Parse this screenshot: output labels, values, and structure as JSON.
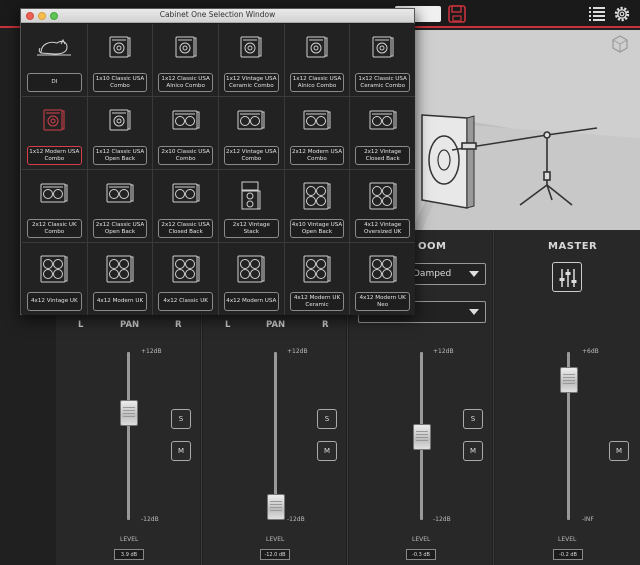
{
  "window": {
    "title": "Cabinet One Selection Window"
  },
  "cabinets": [
    {
      "label": "DI",
      "icon": "di-cat-icon",
      "kind": "di"
    },
    {
      "label": "1x10 Classic USA Combo",
      "icon": "cab-1x10-icon",
      "kind": "combo1"
    },
    {
      "label": "1x12 Classic USA Alnico Combo",
      "icon": "cab-1x12-icon",
      "kind": "combo1"
    },
    {
      "label": "1x12 Vintage USA Ceramic Combo",
      "icon": "cab-1x12-icon",
      "kind": "combo1"
    },
    {
      "label": "1x12 Classic USA Alnico Combo",
      "icon": "cab-1x12-icon",
      "kind": "combo1"
    },
    {
      "label": "1x12 Classic USA Ceramic Combo",
      "icon": "cab-1x12-icon",
      "kind": "combo1"
    },
    {
      "label": "1x12 Modern USA Combo",
      "icon": "cab-1x12-icon",
      "kind": "combo1",
      "selected": true
    },
    {
      "label": "1x12 Classic USA Open Back",
      "icon": "cab-1x12-icon",
      "kind": "combo1"
    },
    {
      "label": "2x10 Classic USA Combo",
      "icon": "cab-2x10-icon",
      "kind": "combo2h"
    },
    {
      "label": "2x12 Vintage USA Combo",
      "icon": "cab-2x12-icon",
      "kind": "combo2h"
    },
    {
      "label": "2x12 Modern USA Combo",
      "icon": "cab-2x12-icon",
      "kind": "combo2h"
    },
    {
      "label": "2x12 Vintage Closed Back",
      "icon": "cab-2x12-icon",
      "kind": "combo2h"
    },
    {
      "label": "2x12 Classic UK Combo",
      "icon": "cab-2x12-icon",
      "kind": "combo2h"
    },
    {
      "label": "2x12 Classic USA Open Back",
      "icon": "cab-2x12-icon",
      "kind": "combo2h"
    },
    {
      "label": "2x12 Classic USA Closed Back",
      "icon": "cab-2x12-icon",
      "kind": "combo2h"
    },
    {
      "label": "2x12 Vintage Stack",
      "icon": "cab-stack-icon",
      "kind": "stack"
    },
    {
      "label": "4x10 Vintage USA Open Back",
      "icon": "cab-4x10-icon",
      "kind": "quad"
    },
    {
      "label": "4x12 Vintage Oversized UK",
      "icon": "cab-4x12-icon",
      "kind": "quad"
    },
    {
      "label": "4x12 Vintage UK",
      "icon": "cab-4x12-icon",
      "kind": "quad"
    },
    {
      "label": "4x12 Modern UK",
      "icon": "cab-4x12-icon",
      "kind": "quad"
    },
    {
      "label": "4x12 Classic UK",
      "icon": "cab-4x12-icon",
      "kind": "quad"
    },
    {
      "label": "4x12 Modern USA",
      "icon": "cab-4x12-icon",
      "kind": "quad"
    },
    {
      "label": "4x12 Modern UK Ceramic",
      "icon": "cab-4x12-icon",
      "kind": "quad"
    },
    {
      "label": "4x12 Modern UK Neo",
      "icon": "cab-4x12-icon",
      "kind": "quad"
    }
  ],
  "room": {
    "header": "OOM",
    "mode": "Damped",
    "second": ""
  },
  "master": {
    "header": "MASTER"
  },
  "pan": {
    "l": "L",
    "pan": "PAN",
    "r": "R"
  },
  "channels": [
    {
      "max": "+12dB",
      "min": "-12dB",
      "level_label": "LEVEL",
      "value": "3.9 dB",
      "level": 0.66
    },
    {
      "max": "+12dB",
      "min": "-12dB",
      "level_label": "LEVEL",
      "value": "-12.0 dB",
      "level": 0.0
    },
    {
      "max": "+12dB",
      "min": "-12dB",
      "level_label": "LEVEL",
      "value": "-0.3 dB",
      "level": 0.49
    }
  ],
  "master_channel": {
    "max": "+6dB",
    "min": "-INF",
    "level_label": "LEVEL",
    "value": "-0.2 dB"
  },
  "buttons": {
    "s": "S",
    "m": "M"
  }
}
